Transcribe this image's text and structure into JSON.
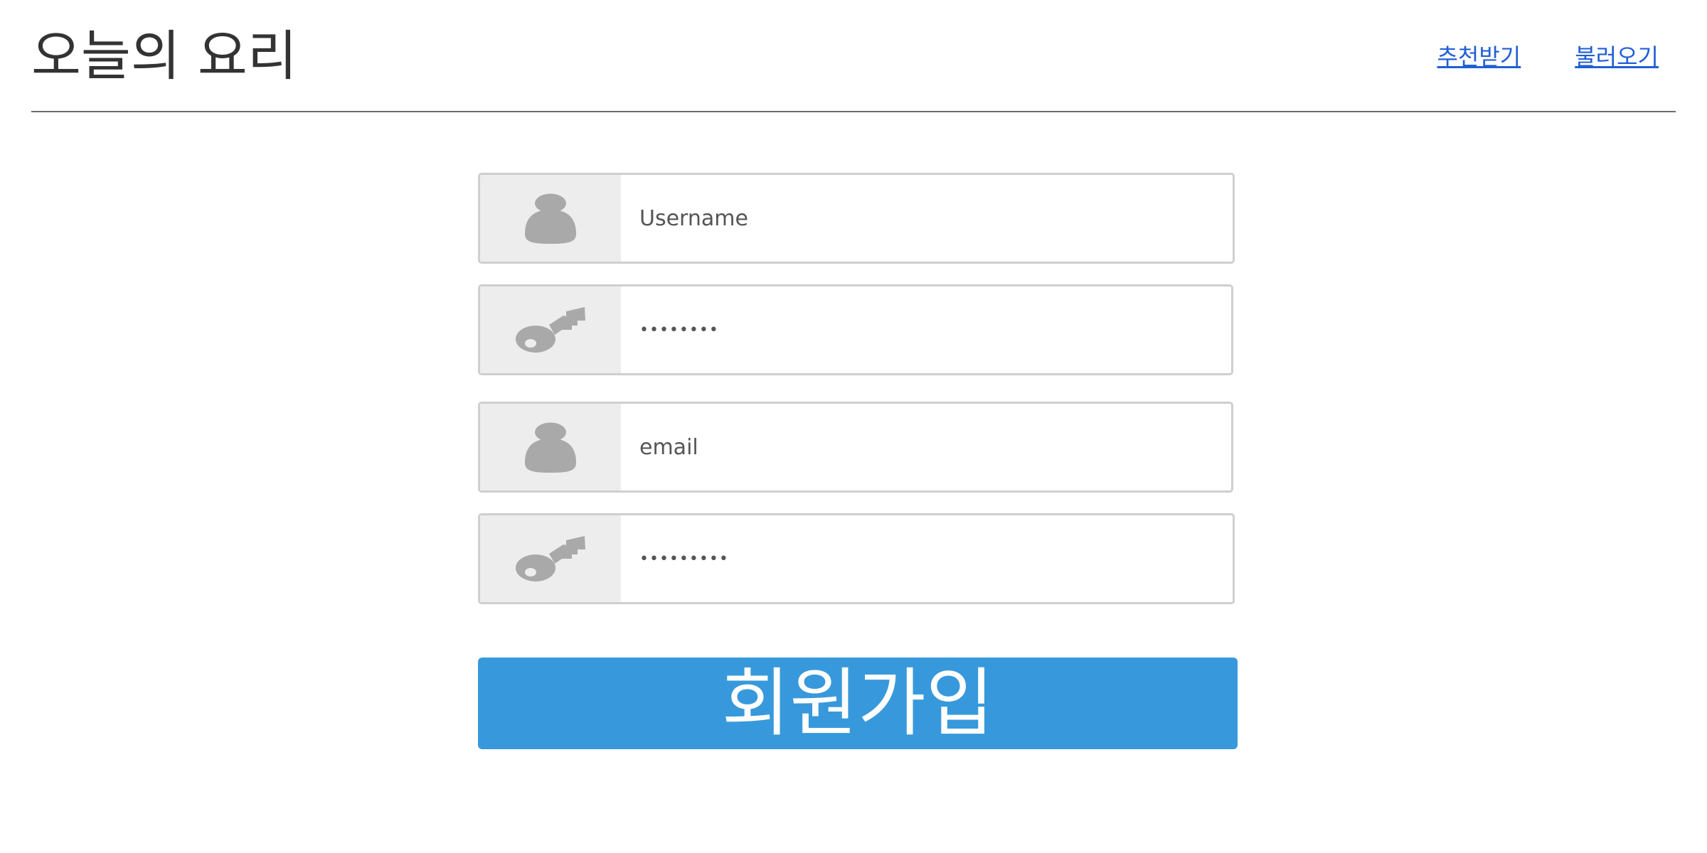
{
  "header": {
    "title": "오늘의 요리",
    "nav": [
      {
        "label": "추천받기"
      },
      {
        "label": "불러오기"
      }
    ]
  },
  "form": {
    "fields": [
      {
        "icon": "user-icon",
        "type": "text",
        "placeholder": "Username",
        "value": ""
      },
      {
        "icon": "key-icon",
        "type": "password",
        "placeholder": "",
        "value": "12345678"
      },
      {
        "icon": "user-icon",
        "type": "text",
        "placeholder": "email",
        "value": ""
      },
      {
        "icon": "key-icon",
        "type": "password",
        "placeholder": "",
        "value": "123456789"
      }
    ],
    "submit_label": "회원가입"
  },
  "colors": {
    "accent": "#3799db",
    "link": "#1f5fd6",
    "icon": "#a9a9a9",
    "addon_bg": "#ededed",
    "field_border": "#cfcfcf"
  }
}
